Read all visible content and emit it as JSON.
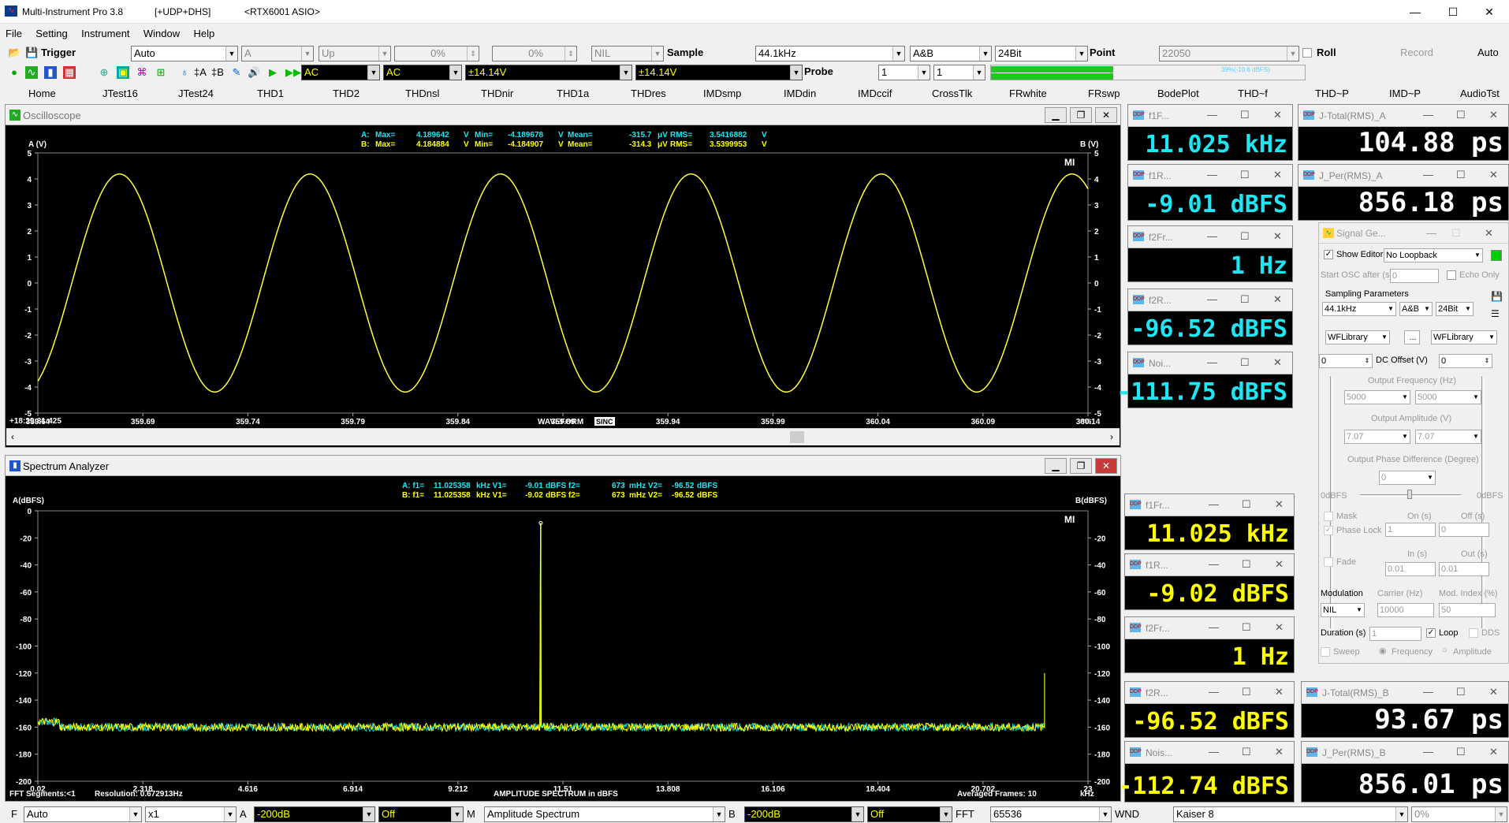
{
  "window": {
    "title": "Multi-Instrument Pro 3.8",
    "mode": "[+UDP+DHS]",
    "device": "<RTX6001 ASIO>",
    "min": "—",
    "max": "☐",
    "close": "✕"
  },
  "menu": [
    "File",
    "Setting",
    "Instrument",
    "Window",
    "Help"
  ],
  "toolbar1": {
    "trigger_label": "Trigger",
    "trigger_mode": "Auto",
    "channel": "A",
    "edge": "Up",
    "level1": "0%",
    "level2": "0%",
    "nil": "NIL",
    "sample_label": "Sample",
    "sample_rate": "44.1kHz",
    "channels": "A&B",
    "bits": "24Bit",
    "point_label": "Point",
    "points": "22050",
    "roll_label": "Roll",
    "record_label": "Record",
    "auto_label": "Auto"
  },
  "toolbar2": {
    "coupling_a": "AC",
    "coupling_b": "AC",
    "range_a": "±14.14V",
    "range_b": "±14.14V",
    "probe_label": "Probe",
    "probe_a": "1",
    "probe_b": "1",
    "level_text": "39%(-10.6 dBFS)"
  },
  "tabs": [
    "Home",
    "JTest16",
    "JTest24",
    "THD1",
    "THD2",
    "THDnsl",
    "THDnir",
    "THD1a",
    "THDres",
    "IMDsmp",
    "IMDdin",
    "IMDccif",
    "CrossTlk",
    "FRwhite",
    "FRswp",
    "BodePlot",
    "THD~f",
    "THD~P",
    "IMD~P",
    "AudioTst"
  ],
  "oscilloscope": {
    "title": "Oscilloscope",
    "stats": {
      "a_label": "A:",
      "b_label": "B:",
      "max_label": "Max=",
      "min_label": "Min=",
      "mean_label": "Mean=",
      "rms_label": "RMS=",
      "v": "V",
      "uv": "μV",
      "a_max": "4.189642",
      "a_min": "-4.189678",
      "a_mean": "-315.7",
      "a_rms": "3.5416882",
      "b_max": "4.184884",
      "b_min": "-4.184907",
      "b_mean": "-314.3",
      "b_rms": "3.5399953"
    },
    "ylabel_left": "A (V)",
    "ylabel_right": "B (V)",
    "timestamp": "+18:29:31:425",
    "xunit": "ms",
    "xlabel": "WAVEFORM",
    "sinc": "SINC",
    "mi": "MI"
  },
  "spectrum": {
    "title": "Spectrum Analyzer",
    "stats": {
      "a_label": "A: f1=",
      "b_label": "B: f1=",
      "khz_v1": "kHz V1=",
      "dbfs_f2": "dBFS f2=",
      "mhz_v2": "mHz V2=",
      "dbfs": "dBFS",
      "a_f1": "11.025358",
      "a_v1": "-9.01",
      "a_f2": "673",
      "a_v2": "-96.52",
      "b_f1": "11.025358",
      "b_v1": "-9.02",
      "b_f2": "673",
      "b_v2": "-96.52"
    },
    "ylabel_left": "A(dBFS)",
    "ylabel_right": "B(dBFS)",
    "fft_segments": "FFT Segments:<1",
    "resolution": "Resolution: 0.672913Hz",
    "xlabel": "AMPLITUDE SPECTRUM in dBFS",
    "averaged": "Averaged Frames: 10",
    "xunit": "kHz",
    "mi": "MI"
  },
  "chart_data": [
    {
      "type": "line",
      "name": "oscilloscope",
      "x_range": [
        359.64,
        360.14
      ],
      "ylim": [
        -5,
        5
      ],
      "x_ticks": [
        "359.64",
        "359.69",
        "359.74",
        "359.79",
        "359.84",
        "359.89",
        "359.94",
        "359.99",
        "360.04",
        "360.09",
        "360.14"
      ],
      "y_ticks_left": [
        "5",
        "4",
        "3",
        "2",
        "1",
        "0",
        "-1",
        "-2",
        "-3",
        "-4",
        "-5"
      ],
      "y_ticks_right": [
        "5",
        "4",
        "3",
        "2",
        "1",
        "0",
        "-1",
        "-2",
        "-3",
        "-4",
        "-5"
      ],
      "series": [
        {
          "channel": "A+B",
          "frequency_khz": 11.025,
          "amplitude_v": 4.19,
          "color": "#ffff40"
        }
      ]
    },
    {
      "type": "line",
      "name": "spectrum",
      "x_range": [
        0.02,
        23
      ],
      "ylim": [
        -200,
        0
      ],
      "x_ticks": [
        "0.02",
        "2.318",
        "4.616",
        "6.914",
        "9.212",
        "11.51",
        "13.808",
        "16.106",
        "18.404",
        "20.702",
        "23"
      ],
      "y_ticks_left": [
        "0",
        "-20",
        "-40",
        "-60",
        "-80",
        "-100",
        "-120",
        "-140",
        "-160",
        "-180",
        "-200"
      ],
      "y_ticks_right": [
        "-20",
        "-40",
        "-60",
        "-80",
        "-100",
        "-120",
        "-140",
        "-160",
        "-180",
        "-200"
      ],
      "series": [
        {
          "channel": "A",
          "noise_floor_dbfs": -160,
          "peak_khz": 11.025,
          "peak_dbfs": -9.01,
          "color": "#ffff00"
        },
        {
          "channel": "B",
          "noise_floor_dbfs": -160,
          "peak_khz": 11.025,
          "peak_dbfs": -9.02,
          "color": "#00d0d0"
        }
      ],
      "edge_peak": {
        "x_khz": 22.05,
        "dbfs": -120
      }
    }
  ],
  "meters": [
    {
      "title": "f1F...",
      "value": "11.025 kHz"
    },
    {
      "title": "J-Total(RMS)_A",
      "value": "104.88 ps"
    },
    {
      "title": "f1R...",
      "value": "-9.01 dBFS"
    },
    {
      "title": "J_Per(RMS)_A",
      "value": "856.18 ps"
    },
    {
      "title": "f2Fr...",
      "value": "1 Hz"
    },
    {
      "title": "f2R...",
      "value": "-96.52 dBFS"
    },
    {
      "title": "Noi...",
      "value": "-111.75 dBFS"
    },
    {
      "title": "f1Fr...",
      "value": "11.025 kHz"
    },
    {
      "title": "f1R...",
      "value": "-9.02 dBFS"
    },
    {
      "title": "f2Fr...",
      "value": "1 Hz"
    },
    {
      "title": "f2R...",
      "value": "-96.52 dBFS"
    },
    {
      "title": "J-Total(RMS)_B",
      "value": "93.67 ps"
    },
    {
      "title": "Nois...",
      "value": "-112.74 dBFS"
    },
    {
      "title": "J_Per(RMS)_B",
      "value": "856.01 ps"
    }
  ],
  "signal_gen": {
    "title": "Signal Ge...",
    "show_editor": "Show Editor",
    "loopback": "No Loopback",
    "start_osc": "Start OSC after (s)",
    "start_val": "0",
    "echo_only": "Echo Only",
    "sampling_params": "Sampling Parameters",
    "rate": "44.1kHz",
    "ch": "A&B",
    "bits": "24Bit",
    "wf1": "WFLibrary",
    "wf2": "WFLibrary",
    "dots": "...",
    "dc_label": "DC Offset (V)",
    "dc_a": "0",
    "dc_b": "0",
    "freq_label": "Output Frequency (Hz)",
    "freq_a": "5000",
    "freq_b": "5000",
    "amp_label": "Output Amplitude (V)",
    "amp_a": "7.07",
    "amp_b": "7.07",
    "phase_label": "Output Phase Difference (Degree)",
    "phase": "0",
    "dbfs_l": "0dBFS",
    "dbfs_r": "0dBFS",
    "mask": "Mask",
    "on_s": "On (s)",
    "off_s": "Off (s)",
    "phase_lock": "Phase Lock",
    "on_val": "1",
    "off_val": "0",
    "fade": "Fade",
    "in_s": "In (s)",
    "out_s": "Out (s)",
    "in_val": "0.01",
    "out_val": "0.01",
    "modulation": "Modulation",
    "carrier": "Carrier (Hz)",
    "mod_index": "Mod. Index (%)",
    "mod_type": "NIL",
    "carrier_val": "10000",
    "mod_val": "50",
    "duration": "Duration (s)",
    "dur_val": "1",
    "loop": "Loop",
    "dds": "DDS",
    "sweep": "Sweep",
    "frequency": "Frequency",
    "amplitude": "Amplitude"
  },
  "statusbar": {
    "f_label": "F",
    "f_mode": "Auto",
    "mult": "x1",
    "a_label": "A",
    "a_range": "-200dB",
    "a_off": "Off",
    "m_label": "M",
    "m_mode": "Amplitude Spectrum",
    "b_label": "B",
    "b_range": "-200dB",
    "b_off": "Off",
    "fft_label": "FFT",
    "fft": "65536",
    "wnd_label": "WND",
    "wnd": "Kaiser 8",
    "pct": "0%"
  }
}
